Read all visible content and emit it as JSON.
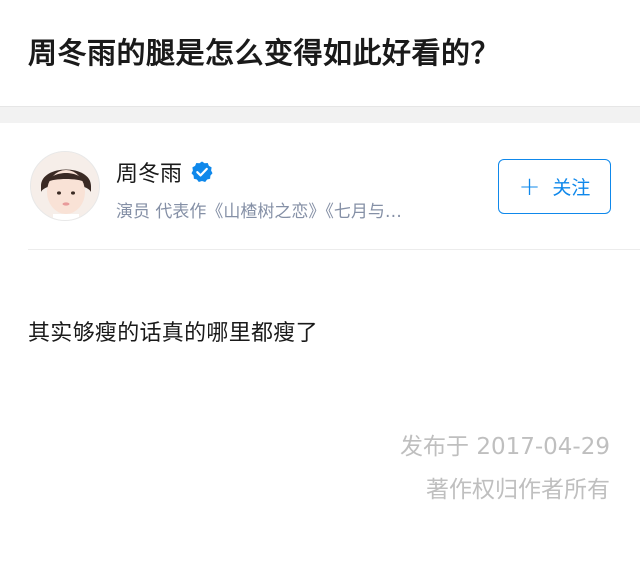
{
  "question": {
    "title": "周冬雨的腿是怎么变得如此好看的？"
  },
  "author": {
    "name": "周冬雨",
    "bio": "演员 代表作《山楂树之恋》《七月与…",
    "verified": true,
    "verified_color": "#0f88eb"
  },
  "follow_button": {
    "icon": "plus-icon",
    "label": "关注",
    "color": "#0f88eb"
  },
  "answer": {
    "content": "其实够瘦的话真的哪里都瘦了",
    "publish_date": "发布于 2017-04-29",
    "copyright": "著作权归作者所有"
  }
}
